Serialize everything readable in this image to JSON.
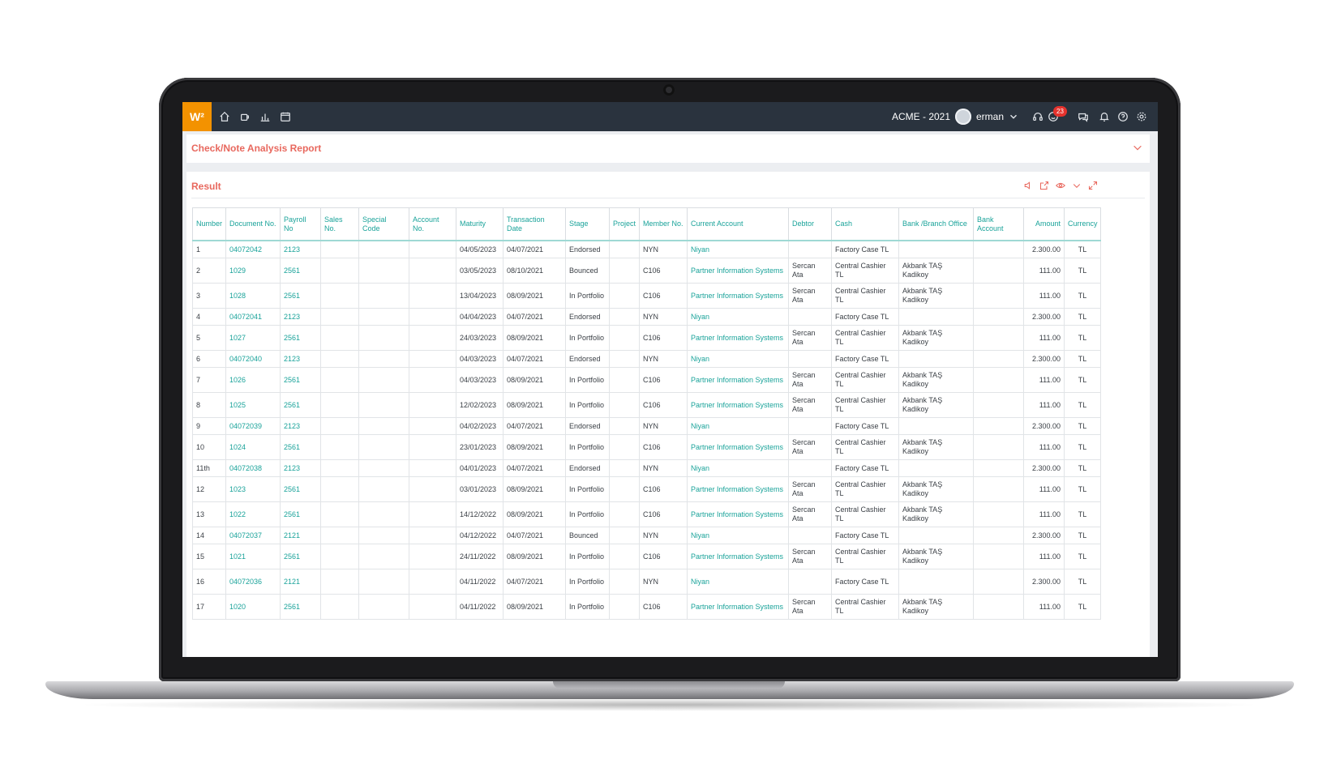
{
  "app": {
    "logo_text": "W²",
    "company": "ACME - 2021",
    "user": "erman",
    "notification_count": "23",
    "accent": "#f39200",
    "title_color": "#e8685e",
    "link_color": "#1aa39a"
  },
  "report": {
    "title": "Check/Note Analysis Report"
  },
  "result": {
    "title": "Result"
  },
  "table": {
    "headers": [
      "Number",
      "Document No.",
      "Payroll No",
      "Sales No.",
      "Special Code",
      "Account No.",
      "Maturity",
      "Transaction Date",
      "Stage",
      "Project",
      "Member No.",
      "Current Account",
      "Debtor",
      "Cash",
      "Bank /Branch Office",
      "Bank Account",
      "Amount",
      "Currency"
    ],
    "rows": [
      [
        "1",
        "04072042",
        "2123",
        "",
        "",
        "",
        "04/05/2023",
        "04/07/2021",
        "Endorsed",
        "",
        "NYN",
        "Niyan",
        "",
        "Factory Case TL",
        "",
        "",
        "2.300.00",
        "TL"
      ],
      [
        "2",
        "1029",
        "2561",
        "",
        "",
        "",
        "03/05/2023",
        "08/10/2021",
        "Bounced",
        "",
        "C106",
        "Partner Information Systems",
        "Sercan Ata",
        "Central Cashier TL",
        "Akbank TAŞ Kadikoy",
        "",
        "111.00",
        "TL"
      ],
      [
        "3",
        "1028",
        "2561",
        "",
        "",
        "",
        "13/04/2023",
        "08/09/2021",
        "In Portfolio",
        "",
        "C106",
        "Partner Information Systems",
        "Sercan Ata",
        "Central Cashier TL",
        "Akbank TAŞ Kadikoy",
        "",
        "111.00",
        "TL"
      ],
      [
        "4",
        "04072041",
        "2123",
        "",
        "",
        "",
        "04/04/2023",
        "04/07/2021",
        "Endorsed",
        "",
        "NYN",
        "Niyan",
        "",
        "Factory Case TL",
        "",
        "",
        "2.300.00",
        "TL"
      ],
      [
        "5",
        "1027",
        "2561",
        "",
        "",
        "",
        "24/03/2023",
        "08/09/2021",
        "In Portfolio",
        "",
        "C106",
        "Partner Information Systems",
        "Sercan Ata",
        "Central Cashier TL",
        "Akbank TAŞ Kadikoy",
        "",
        "111.00",
        "TL"
      ],
      [
        "6",
        "04072040",
        "2123",
        "",
        "",
        "",
        "04/03/2023",
        "04/07/2021",
        "Endorsed",
        "",
        "NYN",
        "Niyan",
        "",
        "Factory Case TL",
        "",
        "",
        "2.300.00",
        "TL"
      ],
      [
        "7",
        "1026",
        "2561",
        "",
        "",
        "",
        "04/03/2023",
        "08/09/2021",
        "In Portfolio",
        "",
        "C106",
        "Partner Information Systems",
        "Sercan Ata",
        "Central Cashier TL",
        "Akbank TAŞ Kadikoy",
        "",
        "111.00",
        "TL"
      ],
      [
        "8",
        "1025",
        "2561",
        "",
        "",
        "",
        "12/02/2023",
        "08/09/2021",
        "In Portfolio",
        "",
        "C106",
        "Partner Information Systems",
        "Sercan Ata",
        "Central Cashier TL",
        "Akbank TAŞ Kadikoy",
        "",
        "111.00",
        "TL"
      ],
      [
        "9",
        "04072039",
        "2123",
        "",
        "",
        "",
        "04/02/2023",
        "04/07/2021",
        "Endorsed",
        "",
        "NYN",
        "Niyan",
        "",
        "Factory Case TL",
        "",
        "",
        "2.300.00",
        "TL"
      ],
      [
        "10",
        "1024",
        "2561",
        "",
        "",
        "",
        "23/01/2023",
        "08/09/2021",
        "In Portfolio",
        "",
        "C106",
        "Partner Information Systems",
        "Sercan Ata",
        "Central Cashier TL",
        "Akbank TAŞ Kadikoy",
        "",
        "111.00",
        "TL"
      ],
      [
        "11th",
        "04072038",
        "2123",
        "",
        "",
        "",
        "04/01/2023",
        "04/07/2021",
        "Endorsed",
        "",
        "NYN",
        "Niyan",
        "",
        "Factory Case TL",
        "",
        "",
        "2.300.00",
        "TL"
      ],
      [
        "12",
        "1023",
        "2561",
        "",
        "",
        "",
        "03/01/2023",
        "08/09/2021",
        "In Portfolio",
        "",
        "C106",
        "Partner Information Systems",
        "Sercan Ata",
        "Central Cashier TL",
        "Akbank TAŞ Kadikoy",
        "",
        "111.00",
        "TL"
      ],
      [
        "13",
        "1022",
        "2561",
        "",
        "",
        "",
        "14/12/2022",
        "08/09/2021",
        "In Portfolio",
        "",
        "C106",
        "Partner Information Systems",
        "Sercan Ata",
        "Central Cashier TL",
        "Akbank TAŞ Kadikoy",
        "",
        "111.00",
        "TL"
      ],
      [
        "14",
        "04072037",
        "2121",
        "",
        "",
        "",
        "04/12/2022",
        "04/07/2021",
        "Bounced",
        "",
        "NYN",
        "Niyan",
        "",
        "Factory Case TL",
        "",
        "",
        "2.300.00",
        "TL"
      ],
      [
        "15",
        "1021",
        "2561",
        "",
        "",
        "",
        "24/11/2022",
        "08/09/2021",
        "In Portfolio",
        "",
        "C106",
        "Partner Information Systems",
        "Sercan Ata",
        "Central Cashier TL",
        "Akbank TAŞ Kadikoy",
        "",
        "111.00",
        "TL"
      ],
      [
        "16",
        "04072036",
        "2121",
        "",
        "",
        "",
        "04/11/2022",
        "04/07/2021",
        "In Portfolio",
        "",
        "NYN",
        "Niyan",
        "",
        "Factory Case TL",
        "",
        "",
        "2.300.00",
        "TL"
      ],
      [
        "17",
        "1020",
        "2561",
        "",
        "",
        "",
        "04/11/2022",
        "08/09/2021",
        "In Portfolio",
        "",
        "C106",
        "Partner Information Systems",
        "Sercan Ata",
        "Central Cashier TL",
        "Akbank TAŞ Kadikoy",
        "",
        "111.00",
        "TL"
      ]
    ]
  }
}
